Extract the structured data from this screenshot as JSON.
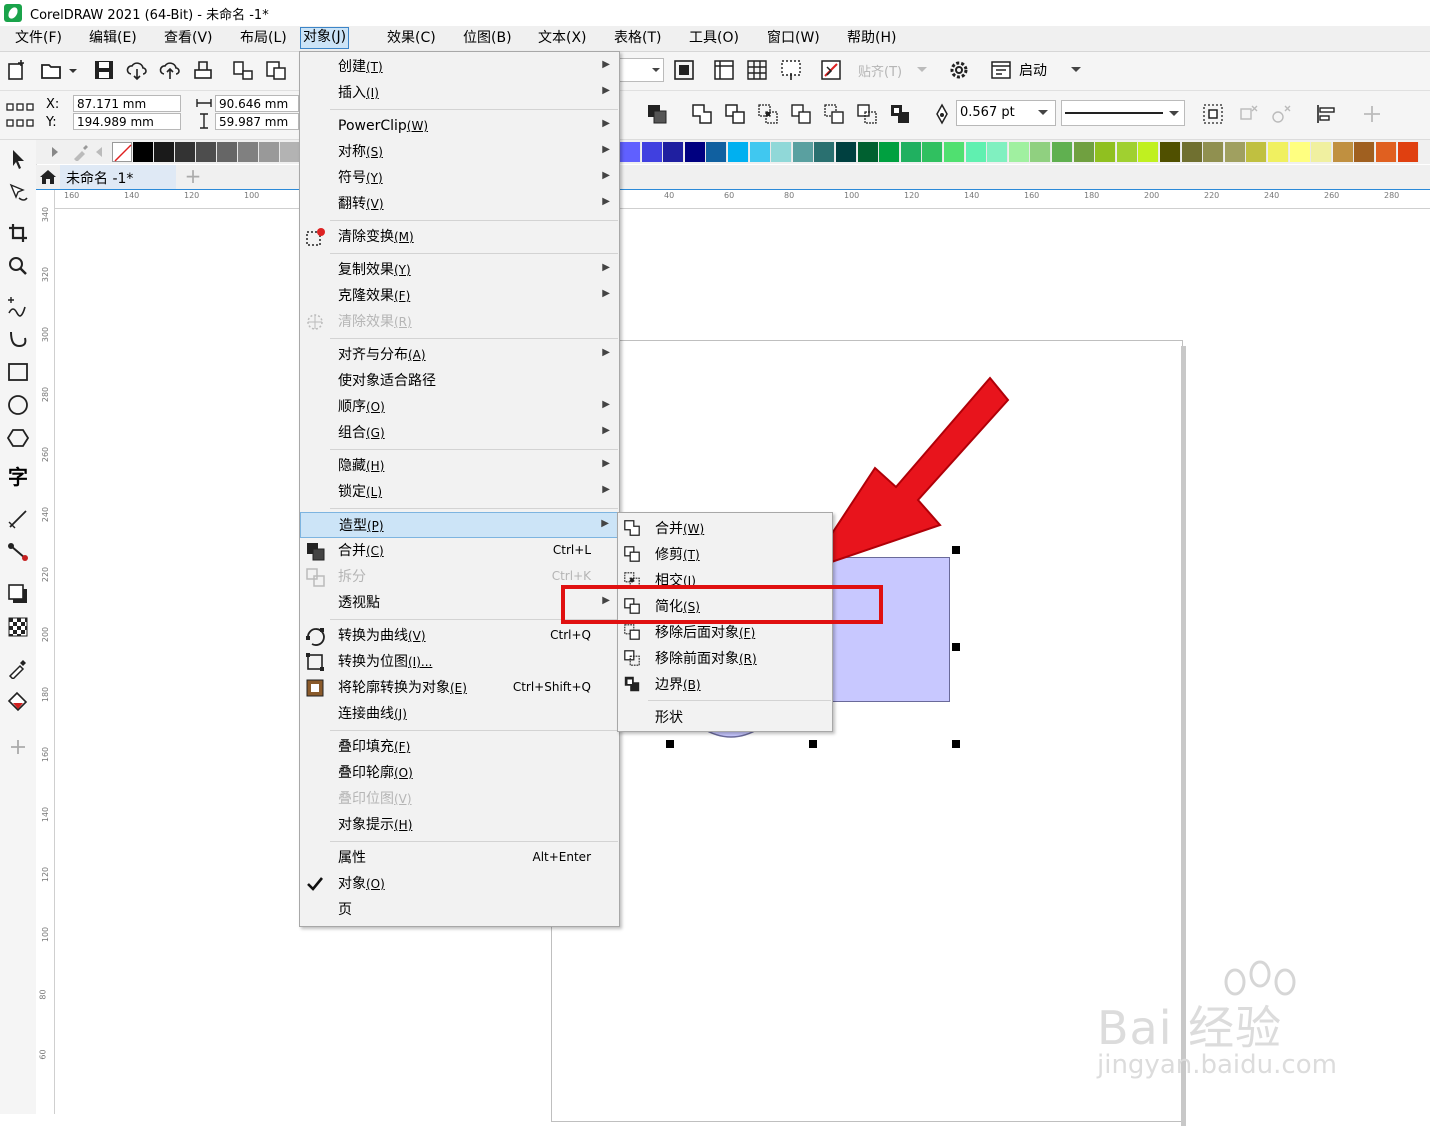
{
  "app": {
    "title": "CorelDRAW 2021 (64-Bit) - 未命名 -1*",
    "brand_color": "#1aa34a"
  },
  "menubar": [
    {
      "label": "文件(F)",
      "key": "file"
    },
    {
      "label": "编辑(E)",
      "key": "edit"
    },
    {
      "label": "查看(V)",
      "key": "view"
    },
    {
      "label": "布局(L)",
      "key": "layout"
    },
    {
      "label": "对象(J)",
      "key": "object"
    },
    {
      "label": "效果(C)",
      "key": "effects"
    },
    {
      "label": "位图(B)",
      "key": "bitmaps"
    },
    {
      "label": "文本(X)",
      "key": "text"
    },
    {
      "label": "表格(T)",
      "key": "table"
    },
    {
      "label": "工具(O)",
      "key": "tools"
    },
    {
      "label": "窗口(W)",
      "key": "window"
    },
    {
      "label": "帮助(H)",
      "key": "help"
    }
  ],
  "toolbar": {
    "snap_label": "贴齐(T)",
    "launch_label": "启动"
  },
  "propbar": {
    "x_label": "X:",
    "y_label": "Y:",
    "x_value": "87.171 mm",
    "y_value": "194.989 mm",
    "w_value": "90.646 mm",
    "h_value": "59.987 mm",
    "outline_width": "0.567 pt"
  },
  "doc_tab": {
    "label": "未命名 -1*",
    "add": "+"
  },
  "hruler": {
    "labels": [
      "160",
      "140",
      "120",
      "100",
      "40",
      "60",
      "80",
      "100",
      "120",
      "140",
      "160",
      "180",
      "200",
      "220",
      "240",
      "260",
      "280"
    ]
  },
  "vruler": {
    "labels": [
      "340",
      "320",
      "300",
      "280",
      "260",
      "240",
      "220",
      "200",
      "180",
      "160",
      "140",
      "120",
      "100",
      "80",
      "60"
    ]
  },
  "object_menu": {
    "items": [
      {
        "label": "创建",
        "u": "(T)",
        "submenu": true
      },
      {
        "label": "插入",
        "u": "(I)",
        "submenu": true
      },
      {
        "sep": true
      },
      {
        "label": "PowerClip",
        "u": "(W)",
        "submenu": true
      },
      {
        "label": "对称",
        "u": "(S)",
        "submenu": true
      },
      {
        "label": "符号",
        "u": "(Y)",
        "submenu": true
      },
      {
        "label": "翻转",
        "u": "(V)",
        "submenu": true
      },
      {
        "sep": true
      },
      {
        "label": "清除变换",
        "u": "(M)",
        "icon": "clear-transform-icon"
      },
      {
        "sep": true
      },
      {
        "label": "复制效果",
        "u": "(Y)",
        "submenu": true
      },
      {
        "label": "克隆效果",
        "u": "(F)",
        "submenu": true
      },
      {
        "label": "清除效果",
        "u": "(R)",
        "disabled": true,
        "icon": "clear-effect-icon"
      },
      {
        "sep": true
      },
      {
        "label": "对齐与分布",
        "u": "(A)",
        "submenu": true
      },
      {
        "label": "使对象适合路径",
        "u": ""
      },
      {
        "label": "顺序",
        "u": "(O)",
        "submenu": true
      },
      {
        "label": "组合",
        "u": "(G)",
        "submenu": true
      },
      {
        "sep": true
      },
      {
        "label": "隐藏",
        "u": "(H)",
        "submenu": true
      },
      {
        "label": "锁定",
        "u": "(L)",
        "submenu": true
      },
      {
        "sep": true
      },
      {
        "label": "造型",
        "u": "(P)",
        "submenu": true,
        "highlight": true
      },
      {
        "label": "合并",
        "u": "(C)",
        "shortcut": "Ctrl+L",
        "icon": "combine-icon"
      },
      {
        "label": "拆分",
        "u": "",
        "shortcut": "Ctrl+K",
        "disabled": true,
        "icon": "break-apart-icon"
      },
      {
        "label": "透视點",
        "u": "",
        "submenu": true
      },
      {
        "sep": true
      },
      {
        "label": "转换为曲线",
        "u": "(V)",
        "shortcut": "Ctrl+Q",
        "icon": "convert-to-curves-icon"
      },
      {
        "label": "转换为位图",
        "u": "(I)...",
        "icon": "convert-to-bitmap-icon"
      },
      {
        "label": "将轮廓转换为对象",
        "u": "(E)",
        "shortcut": "Ctrl+Shift+Q",
        "icon": "outline-to-object-icon"
      },
      {
        "label": "连接曲线",
        "u": "(J)"
      },
      {
        "sep": true
      },
      {
        "label": "叠印填充",
        "u": "(F)"
      },
      {
        "label": "叠印轮廓",
        "u": "(O)"
      },
      {
        "label": "叠印位图",
        "u": "(V)",
        "disabled": true
      },
      {
        "label": "对象提示",
        "u": "(H)"
      },
      {
        "sep": true
      },
      {
        "label": "属性",
        "u": "",
        "shortcut": "Alt+Enter"
      },
      {
        "label": "对象",
        "u": "(O)",
        "checked": true
      },
      {
        "label": "页",
        "u": ""
      }
    ]
  },
  "shaping_submenu": {
    "items": [
      {
        "label": "合并",
        "u": "(W)",
        "icon": "weld-icon"
      },
      {
        "label": "修剪",
        "u": "(T)",
        "icon": "trim-icon"
      },
      {
        "label": "相交",
        "u": "(I)",
        "icon": "intersect-icon"
      },
      {
        "label": "简化",
        "u": "(S)",
        "icon": "simplify-icon"
      },
      {
        "label": "移除后面对象",
        "u": "(F)",
        "icon": "front-minus-back-icon"
      },
      {
        "label": "移除前面对象",
        "u": "(R)",
        "icon": "back-minus-front-icon"
      },
      {
        "label": "边界",
        "u": "(B)",
        "icon": "boundary-icon"
      },
      {
        "sep": true
      },
      {
        "label": "形状",
        "u": ""
      }
    ]
  },
  "palette_colors": [
    "#000000",
    "#1a1a1a",
    "#333333",
    "#4d4d4d",
    "#666666",
    "#808080",
    "#999999",
    "#b3b3b3",
    "#6060ff",
    "#4040e0",
    "#1f1fa0",
    "#000080",
    "#1060a0",
    "#00b0f0",
    "#40c8f0",
    "#90d8d8",
    "#5aa0a0",
    "#2a7070",
    "#004040",
    "#006030",
    "#00a040",
    "#20b060",
    "#30c060",
    "#50e070",
    "#60f0b0",
    "#80f0c0",
    "#a0f0a0",
    "#90d080",
    "#60b050",
    "#70a040",
    "#90c020",
    "#a0d030",
    "#c0f020",
    "#505000",
    "#707030",
    "#909050",
    "#a0a060",
    "#c0c040",
    "#f0f060",
    "#ffff80",
    "#f0f0a0",
    "#c09040",
    "#a06020",
    "#e06020",
    "#e04010"
  ],
  "watermark": {
    "line1": "Bai 经验",
    "line2": "jingyan.baidu.com"
  }
}
